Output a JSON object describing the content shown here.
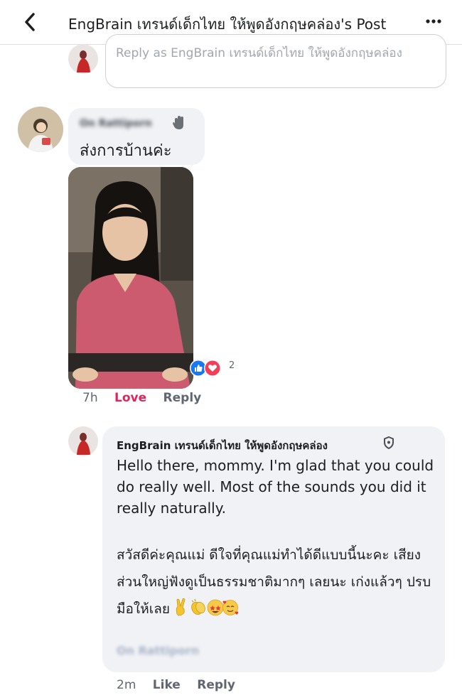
{
  "header": {
    "title": "EngBrain เทรนด์เด็กไทย ให้พูดอังกฤษคล่อง's Post",
    "back_icon": "chevron-left-icon",
    "more_icon": "more-horizontal-icon"
  },
  "composer": {
    "placeholder": "Reply as EngBrain เทรนด์เด็กไทย ให้พูดอังกฤษคล่อง"
  },
  "comment": {
    "author": "On Rattiporn",
    "text": "ส่งการบ้านค่ะ",
    "reaction_count": "2",
    "time": "7h",
    "love_label": "Love",
    "reply_label": "Reply"
  },
  "reply": {
    "author": "EngBrain เทรนด์เด็กไทย ให้พูดอังกฤษคล่อง",
    "text_en": "Hello there, mommy. I'm glad that you could do really well. Most of the sounds you did it really naturally.",
    "text_th": "สวัสดีค่ะคุณแม่ ดีใจที่คุณแม่ทำได้ดีแบบนี้นะคะ เสียงส่วนใหญ่ฟังดูเป็นธรรมชาติมากๆ เลยนะ เก่งแล้วๆ ปรบมือให้เลย",
    "emojis": [
      "victory-hand",
      "clapping-hands",
      "starstruck-face",
      "smiling-face-with-hearts"
    ],
    "tag": "On Rattiporn",
    "time": "2m",
    "like_label": "Like",
    "reply_label": "Reply"
  },
  "colors": {
    "bubble": "#f0f2f5",
    "love": "#e0245e",
    "like_blue": "#1877f2",
    "meta_gray": "#606770"
  }
}
